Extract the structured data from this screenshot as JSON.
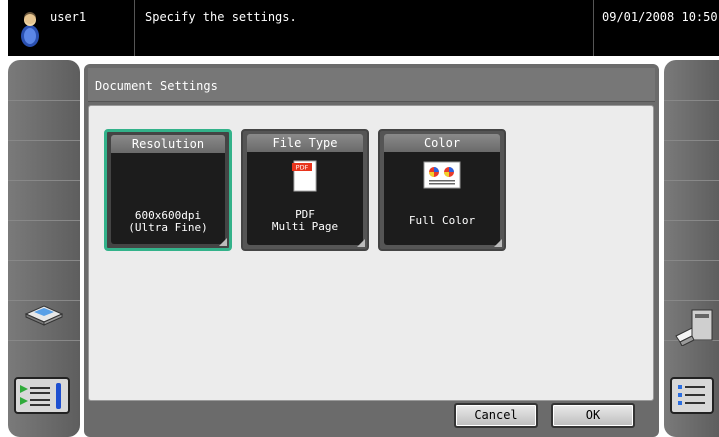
{
  "header": {
    "user_name": "user1",
    "prompt": "Specify the settings.",
    "datetime": "09/01/2008 10:50"
  },
  "panel": {
    "title": "Document Settings"
  },
  "settings": [
    {
      "label": "Resolution",
      "value_line1": "600x600dpi",
      "value_line2": "(Ultra Fine)",
      "selected": true
    },
    {
      "label": "File Type",
      "icon": "pdf-file-icon",
      "icon_text": "PDF",
      "value_line1": "PDF",
      "value_line2": "Multi Page",
      "selected": false
    },
    {
      "label": "Color",
      "icon": "full-color-icon",
      "value_line1": "Full Color",
      "value_line2": "",
      "selected": false
    }
  ],
  "buttons": {
    "cancel": "Cancel",
    "ok": "OK"
  },
  "colors": {
    "selected_border": "#33b28a",
    "topbar": "#000000",
    "panel_bg": "#6b6b6b",
    "content_bg": "#ececec"
  }
}
